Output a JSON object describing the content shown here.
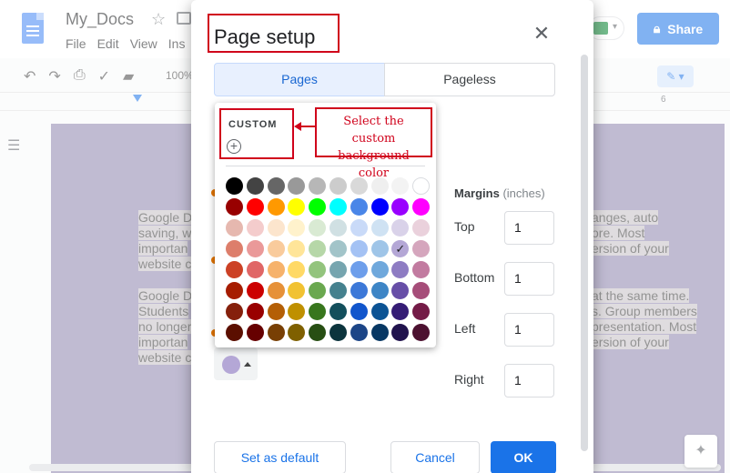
{
  "app": {
    "doc_title": "My_Docs",
    "menu": [
      "File",
      "Edit",
      "View",
      "Ins"
    ],
    "share_label": "Share",
    "zoom": "100%",
    "ruler_numbers": [
      "6"
    ],
    "paragraph1": [
      "Google D",
      "saving, w",
      "importan",
      "website c"
    ],
    "paragraph1_right": [
      "anges, auto",
      "ore. Most",
      "ersion of your"
    ],
    "paragraph2": [
      "Google D",
      "Students",
      "no longer",
      "importan",
      "website c"
    ],
    "paragraph2_right": [
      "at the same time.",
      "s. Group members",
      "presentation. Most",
      "ersion of your"
    ]
  },
  "dialog": {
    "title": "Page setup",
    "tabs": [
      {
        "label": "Pages",
        "active": true
      },
      {
        "label": "Pageless",
        "active": false
      }
    ],
    "margins": {
      "title": "Margins",
      "unit": "(inches)",
      "top_label": "Top",
      "top_value": "1",
      "bottom_label": "Bottom",
      "bottom_value": "1",
      "left_label": "Left",
      "left_value": "1",
      "right_label": "Right",
      "right_value": "1"
    },
    "page_color": "#b4a7d6",
    "buttons": {
      "set_default": "Set as default",
      "cancel": "Cancel",
      "ok": "OK"
    }
  },
  "palette": {
    "custom_label": "CUSTOM",
    "add_symbol": "+",
    "selected_color": "#b4a7d6",
    "colors": [
      [
        "#000000",
        "#434343",
        "#666666",
        "#999999",
        "#b7b7b7",
        "#cccccc",
        "#d9d9d9",
        "#efefef",
        "#f3f3f3",
        "#ffffff"
      ],
      [
        "#980000",
        "#ff0000",
        "#ff9900",
        "#ffff00",
        "#00ff00",
        "#00ffff",
        "#4a86e8",
        "#0000ff",
        "#9900ff",
        "#ff00ff"
      ],
      [
        "#e6b8af",
        "#f4cccc",
        "#fce5cd",
        "#fff2cc",
        "#d9ead3",
        "#d0e0e3",
        "#c9daf8",
        "#cfe2f3",
        "#d9d2e9",
        "#ead1dc"
      ],
      [
        "#dd7e6b",
        "#ea9999",
        "#f9cb9c",
        "#ffe599",
        "#b6d7a8",
        "#a2c4c9",
        "#a4c2f4",
        "#9fc5e8",
        "#b4a7d6",
        "#d5a6bd"
      ],
      [
        "#cc4125",
        "#e06666",
        "#f6b26b",
        "#ffd966",
        "#93c47d",
        "#76a5af",
        "#6d9eeb",
        "#6fa8dc",
        "#8e7cc3",
        "#c27ba0"
      ],
      [
        "#a61c00",
        "#cc0000",
        "#e69138",
        "#f1c232",
        "#6aa84f",
        "#45818e",
        "#3c78d8",
        "#3d85c6",
        "#674ea7",
        "#a64d79"
      ],
      [
        "#85200c",
        "#990000",
        "#b45f06",
        "#bf9000",
        "#38761d",
        "#134f5c",
        "#1155cc",
        "#0b5394",
        "#351c75",
        "#741b47"
      ],
      [
        "#5b0f00",
        "#660000",
        "#783f04",
        "#7f6000",
        "#274e13",
        "#0c343d",
        "#1c4587",
        "#073763",
        "#20124d",
        "#4c1130"
      ]
    ]
  },
  "annotation": {
    "text": "Select the custom background color",
    "color": "#d0021b"
  }
}
